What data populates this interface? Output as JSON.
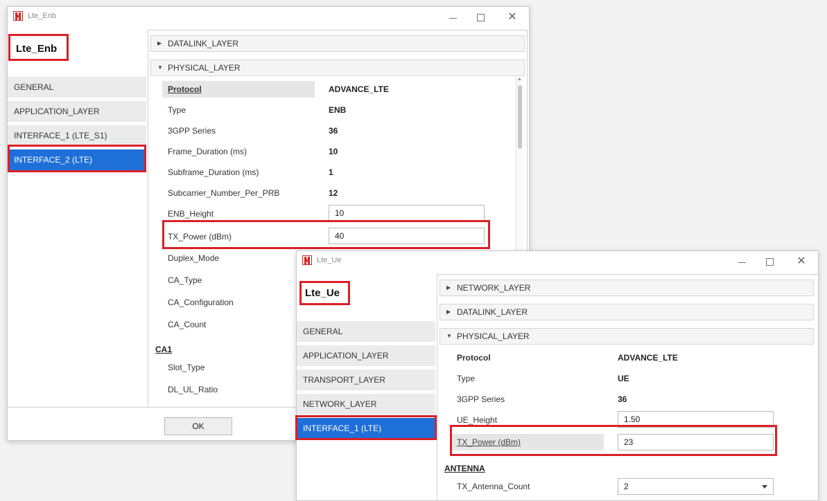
{
  "enb": {
    "window_title": "Lte_Enb",
    "device_name": "Lte_Enb",
    "sidebar": [
      "GENERAL",
      "APPLICATION_LAYER",
      "INTERFACE_1 (LTE_S1)",
      "INTERFACE_2 (LTE)"
    ],
    "selected": "INTERFACE_2 (LTE)",
    "sections": {
      "datalink": "DATALINK_LAYER",
      "physical": "PHYSICAL_LAYER"
    },
    "props": {
      "protocol": {
        "label": "Protocol",
        "value": "ADVANCE_LTE"
      },
      "type": {
        "label": "Type",
        "value": "ENB"
      },
      "series": {
        "label": "3GPP Series",
        "value": "36"
      },
      "frame": {
        "label": "Frame_Duration (ms)",
        "value": "10"
      },
      "subframe": {
        "label": "Subframe_Duration (ms)",
        "value": "1"
      },
      "subcarrier": {
        "label": "Subcarrier_Number_Per_PRB",
        "value": "12"
      },
      "enb_height": {
        "label": "ENB_Height",
        "value": "10"
      },
      "tx_power": {
        "label": "TX_Power (dBm)",
        "value": "40"
      },
      "duplex": {
        "label": "Duplex_Mode"
      },
      "ca_type": {
        "label": "CA_Type"
      },
      "ca_config": {
        "label": "CA_Configuration"
      },
      "ca_count": {
        "label": "CA_Count"
      },
      "ca1_group": "CA1",
      "slot_type": {
        "label": "Slot_Type"
      },
      "dl_ul": {
        "label": "DL_UL_Ratio"
      }
    },
    "ok_label": "OK"
  },
  "ue": {
    "window_title": "Lte_Ue",
    "device_name": "Lte_Ue",
    "sidebar": [
      "GENERAL",
      "APPLICATION_LAYER",
      "TRANSPORT_LAYER",
      "NETWORK_LAYER",
      "INTERFACE_1 (LTE)"
    ],
    "selected": "INTERFACE_1 (LTE)",
    "sections": {
      "network": "NETWORK_LAYER",
      "datalink": "DATALINK_LAYER",
      "physical": "PHYSICAL_LAYER"
    },
    "props": {
      "protocol": {
        "label": "Protocol",
        "value": "ADVANCE_LTE"
      },
      "type": {
        "label": "Type",
        "value": "UE"
      },
      "series": {
        "label": "3GPP Series",
        "value": "36"
      },
      "ue_height": {
        "label": "UE_Height",
        "value": "1.50"
      },
      "tx_power": {
        "label": "TX_Power (dBm)",
        "value": "23"
      },
      "antenna_group": "ANTENNA",
      "tx_antenna": {
        "label": "TX_Antenna_Count",
        "value": "2"
      }
    }
  },
  "colors": {
    "highlight": "#dc1f26",
    "selected": "#1f6fd9"
  }
}
